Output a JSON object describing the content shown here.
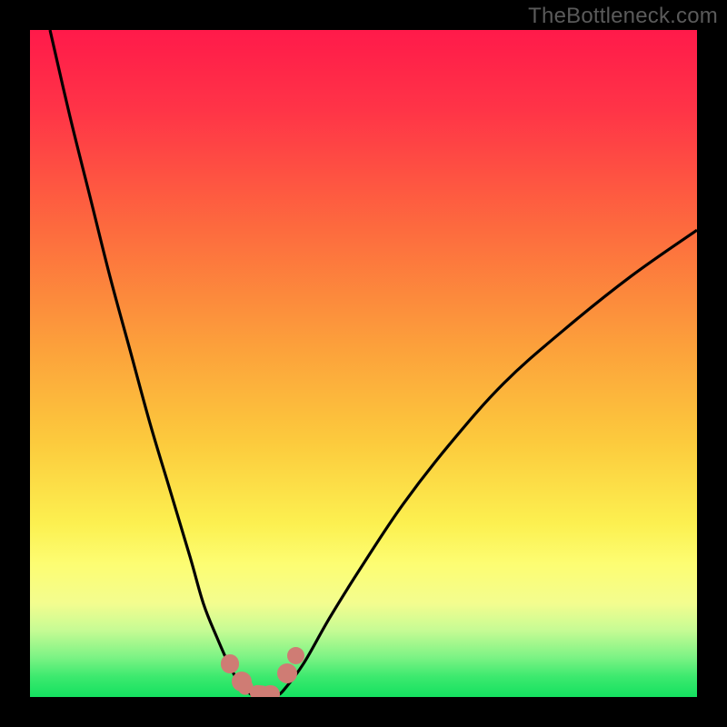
{
  "watermark": "TheBottleneck.com",
  "colors": {
    "marker": "#cf7c74",
    "curve": "#000000",
    "frame_bg": "#000000"
  },
  "chart_data": {
    "type": "line",
    "title": "",
    "xlabel": "",
    "ylabel": "",
    "xlim": [
      0,
      100
    ],
    "ylim": [
      0,
      100
    ],
    "grid": false,
    "legend": false,
    "background_gradient": [
      {
        "pos": 0.0,
        "color": "#ff1a4a"
      },
      {
        "pos": 0.12,
        "color": "#ff3447"
      },
      {
        "pos": 0.3,
        "color": "#fd6b3e"
      },
      {
        "pos": 0.48,
        "color": "#fca23b"
      },
      {
        "pos": 0.62,
        "color": "#fccb3d"
      },
      {
        "pos": 0.74,
        "color": "#fcf050"
      },
      {
        "pos": 0.8,
        "color": "#fdfd72"
      },
      {
        "pos": 0.86,
        "color": "#f3fd8f"
      },
      {
        "pos": 0.9,
        "color": "#c6fb94"
      },
      {
        "pos": 0.94,
        "color": "#7df385"
      },
      {
        "pos": 0.97,
        "color": "#3ce96e"
      },
      {
        "pos": 1.0,
        "color": "#14e160"
      }
    ],
    "series": [
      {
        "name": "left-branch",
        "x": [
          3,
          6,
          9,
          12,
          15,
          18,
          21,
          24,
          26,
          28,
          30,
          31.5,
          33
        ],
        "y": [
          100,
          87,
          75,
          63,
          52,
          41,
          31,
          21,
          14,
          9,
          4.5,
          2,
          0.5
        ]
      },
      {
        "name": "valley",
        "x": [
          33,
          34,
          35,
          36,
          37,
          38
        ],
        "y": [
          0.5,
          0.2,
          0.1,
          0.1,
          0.3,
          1.0
        ]
      },
      {
        "name": "right-branch",
        "x": [
          38,
          41,
          45,
          50,
          56,
          63,
          71,
          80,
          90,
          100
        ],
        "y": [
          1.0,
          5,
          12,
          20,
          29,
          38,
          47,
          55,
          63,
          70
        ]
      }
    ],
    "markers": [
      {
        "kind": "dot",
        "x": 30.0,
        "y": 5.0,
        "r": 1.4
      },
      {
        "kind": "dot",
        "x": 31.8,
        "y": 2.3,
        "r": 1.5
      },
      {
        "kind": "seg",
        "x1": 31.8,
        "y1": 2.3,
        "x2": 33.0,
        "y2": 0.7,
        "w": 2.3
      },
      {
        "kind": "seg",
        "x1": 33.0,
        "y1": 0.7,
        "x2": 36.0,
        "y2": 0.4,
        "w": 2.3
      },
      {
        "kind": "dot",
        "x": 36.0,
        "y": 0.4,
        "r": 1.4
      },
      {
        "kind": "dot",
        "x": 38.5,
        "y": 3.5,
        "r": 1.5
      },
      {
        "kind": "dot",
        "x": 39.8,
        "y": 6.2,
        "r": 1.3
      }
    ]
  }
}
